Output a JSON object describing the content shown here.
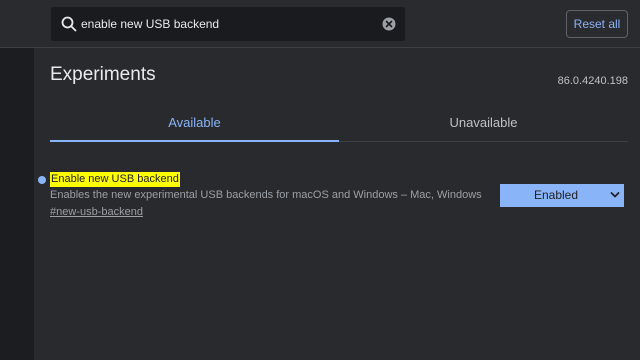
{
  "search": {
    "value": "enable new USB backend",
    "icon": "search-icon",
    "clear_icon": "clear-icon"
  },
  "header": {
    "reset_label": "Reset all"
  },
  "page": {
    "title": "Experiments",
    "version": "86.0.4240.198"
  },
  "tabs": [
    {
      "label": "Available",
      "active": true
    },
    {
      "label": "Unavailable",
      "active": false
    }
  ],
  "experiments": [
    {
      "title": "Enable new USB backend",
      "description": "Enables the new experimental USB backends for macOS and Windows – Mac, Windows",
      "link": "#new-usb-backend",
      "state": "Enabled"
    }
  ],
  "colors": {
    "accent": "#8ab4f8",
    "highlight": "#ffff00",
    "background": "#292a2d",
    "topbar": "#2a2b2e"
  }
}
